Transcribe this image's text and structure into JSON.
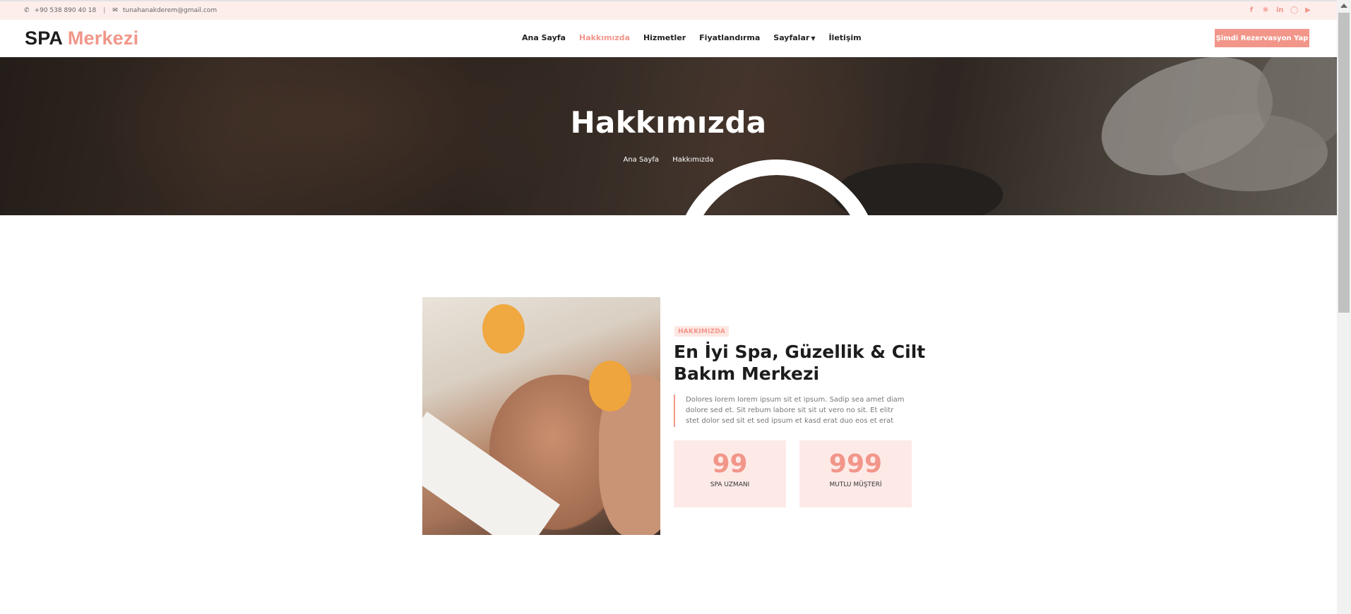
{
  "topbar": {
    "phone_icon": "phone-icon",
    "phone": "+90 538 890 40 18",
    "separator": "|",
    "email_icon": "envelope-icon",
    "email": "tunahanakderem@gmail.com",
    "social": [
      "facebook-icon",
      "twitter-icon",
      "linkedin-icon",
      "instagram-icon",
      "youtube-icon"
    ]
  },
  "brand": {
    "part1": "SPA",
    "part2": "Merkezi"
  },
  "nav": {
    "items": [
      {
        "label": "Ana Sayfa",
        "active": false
      },
      {
        "label": "Hakkımızda",
        "active": true
      },
      {
        "label": "Hizmetler",
        "active": false
      },
      {
        "label": "Fiyatlandırma",
        "active": false
      },
      {
        "label": "Sayfalar",
        "active": false,
        "dropdown": true
      },
      {
        "label": "İletişim",
        "active": false
      }
    ],
    "cta": "Şimdi Rezervasyon Yap"
  },
  "hero": {
    "title": "Hakkımızda",
    "breadcrumb": [
      "Ana Sayfa",
      "Hakkımızda"
    ]
  },
  "about": {
    "tag": "HAKKIMIZDA",
    "heading": "En İyi Spa, Güzellik & Cilt Bakım Merkezi",
    "description": "Dolores lorem lorem ipsum sit et ipsum. Sadip sea amet diam dolore sed et. Sit rebum labore sit sit ut vero no sit. Et elitr stet dolor sed sit et sed ipsum et kasd erat duo eos et erat",
    "stats": [
      {
        "number": "99",
        "label": "SPA UZMANI"
      },
      {
        "number": "999",
        "label": "MUTLU MÜŞTERİ"
      }
    ]
  },
  "colors": {
    "accent": "#F2968A",
    "topbar_bg": "#FDEEEC",
    "stat_bg": "#FDEAE7"
  }
}
